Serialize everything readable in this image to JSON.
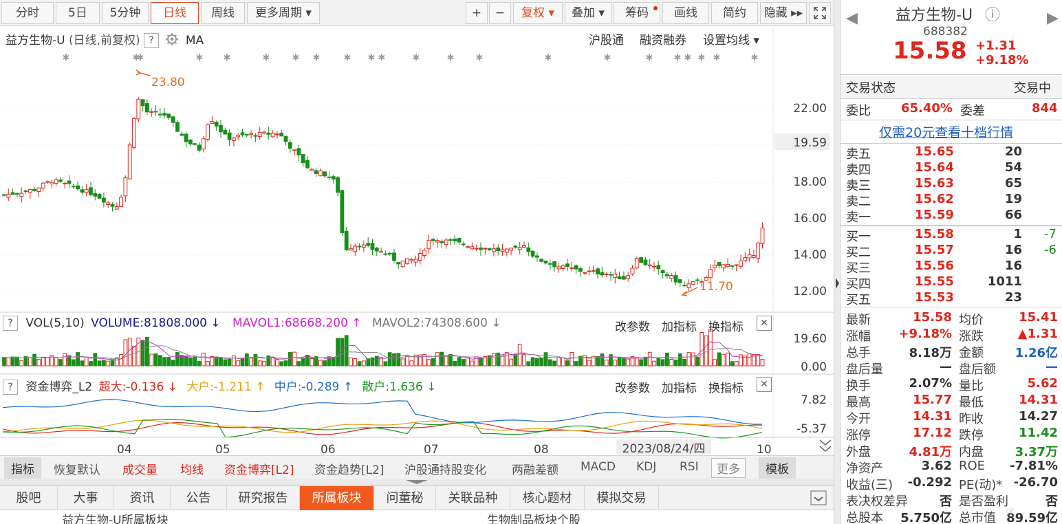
{
  "toolbar": {
    "periods": [
      "分时",
      "5日",
      "5分钟",
      "日线",
      "周线",
      "更多周期 ▾"
    ],
    "active_period": "日线",
    "zoom_in": "+",
    "zoom_out": "−",
    "fuquan": "复权 ▾",
    "overlay": "叠加 ▾",
    "chips": "筹码",
    "draw": "画线",
    "simple": "简约",
    "hide": "隐藏 ▸▸",
    "fullscreen_icon": "expand-icon"
  },
  "kline_header": {
    "title": "益方生物-U",
    "sub": "(日线,前复权)",
    "help": "?",
    "indicator": "MA",
    "links": [
      "沪股通",
      "融资融券",
      "设置均线 ▾"
    ]
  },
  "price_axis": {
    "labels": [
      "22.00",
      "19.59",
      "18.00",
      "16.00",
      "14.00",
      "12.00"
    ],
    "current_marker": "19.59"
  },
  "annotations": {
    "high": "23.80",
    "low": "11.70"
  },
  "vol_header": {
    "help": "?",
    "name": "VOL(5,10)",
    "volume": "VOLUME:81808.000 ↓",
    "mavol1": "MAVOL1:68668.200 ↑",
    "mavol2": "MAVOL2:74308.600 ↓",
    "buttons": [
      "改参数",
      "加指标",
      "换指标"
    ],
    "close": "✕",
    "axis": [
      "19.60",
      "0.00"
    ]
  },
  "fund_header": {
    "help": "?",
    "name": "资金博弈_L2",
    "super": "超大:-0.136 ↓",
    "large": "大户:-1.211 ↑",
    "medium": "中户:-0.289 ↑",
    "retail": "散户:1.636 ↓",
    "buttons": [
      "改参数",
      "加指标",
      "换指标"
    ],
    "close": "✕",
    "axis": [
      "7.82",
      "-5.37"
    ]
  },
  "x_axis": {
    "labels": [
      "04",
      "05",
      "06",
      "07",
      "08",
      "10"
    ],
    "cursor_date": "2023/08/24/四"
  },
  "indicator_tabs": {
    "items": [
      "指标",
      "恢复默认",
      "成交量",
      "均线",
      "资金博弈[L2]",
      "资金趋势[L2]",
      "沪股通持股变化",
      "两融差额",
      "MACD",
      "KDJ",
      "RSI",
      "更多"
    ],
    "template": "模板"
  },
  "bottom_tabs": {
    "items": [
      "股吧",
      "大事",
      "资讯",
      "公告",
      "研究报告",
      "所属板块",
      "问董秘",
      "关联品种",
      "核心题材",
      "模拟交易"
    ],
    "active": "所属板块"
  },
  "bottom_strip": {
    "left": "益方生物-U所属板块",
    "center": "生物制品板块个股"
  },
  "quote": {
    "name": "益方生物-U",
    "info_icon": "ⓘ",
    "code": "688382",
    "price": "15.58",
    "change": "+1.31",
    "change_pct": "+9.18%",
    "prev_icon": "◀",
    "next_icon": "▶"
  },
  "status": {
    "label": "交易状态",
    "value": "交易中"
  },
  "weibi": {
    "l1": "委比",
    "v1": "65.40%",
    "l2": "委差",
    "v2": "844"
  },
  "ten_level": "仅需20元查看十档行情",
  "sell": [
    {
      "label": "卖五",
      "price": "15.65",
      "vol": "20"
    },
    {
      "label": "卖四",
      "price": "15.64",
      "vol": "54"
    },
    {
      "label": "卖三",
      "price": "15.63",
      "vol": "65"
    },
    {
      "label": "卖二",
      "price": "15.62",
      "vol": "19"
    },
    {
      "label": "卖一",
      "price": "15.59",
      "vol": "66"
    }
  ],
  "buy": [
    {
      "label": "买一",
      "price": "15.58",
      "vol": "1",
      "chg": "-7"
    },
    {
      "label": "买二",
      "price": "15.57",
      "vol": "16",
      "chg": "-6"
    },
    {
      "label": "买三",
      "price": "15.56",
      "vol": "16",
      "chg": ""
    },
    {
      "label": "买四",
      "price": "15.55",
      "vol": "1011",
      "chg": ""
    },
    {
      "label": "买五",
      "price": "15.53",
      "vol": "23",
      "chg": ""
    }
  ],
  "stats": [
    {
      "l1": "最新",
      "v1": "15.58",
      "c1": "red",
      "l2": "均价",
      "v2": "15.41",
      "c2": "red"
    },
    {
      "l1": "涨幅",
      "v1": "+9.18%",
      "c1": "red",
      "l2": "涨跌",
      "v2": "▲1.31",
      "c2": "red"
    },
    {
      "l1": "总手",
      "v1": "8.18万",
      "c1": "",
      "l2": "金额",
      "v2": "1.26亿",
      "c2": "blue"
    },
    {
      "l1": "盘后量",
      "v1": "—",
      "c1": "",
      "l2": "盘后额",
      "v2": "—",
      "c2": "blue"
    },
    {
      "l1": "换手",
      "v1": "2.07%",
      "c1": "",
      "l2": "量比",
      "v2": "5.62",
      "c2": "red"
    },
    {
      "l1": "最高",
      "v1": "15.77",
      "c1": "red",
      "l2": "最低",
      "v2": "14.31",
      "c2": "red"
    },
    {
      "l1": "今开",
      "v1": "14.31",
      "c1": "red",
      "l2": "昨收",
      "v2": "14.27",
      "c2": ""
    },
    {
      "l1": "涨停",
      "v1": "17.12",
      "c1": "red",
      "l2": "跌停",
      "v2": "11.42",
      "c2": "green"
    },
    {
      "l1": "外盘",
      "v1": "4.81万",
      "c1": "red",
      "l2": "内盘",
      "v2": "3.37万",
      "c2": "green"
    },
    {
      "l1": "净资产",
      "v1": "3.62",
      "c1": "",
      "l2": "ROE",
      "v2": "-7.81%",
      "c2": ""
    },
    {
      "l1": "收益(三)",
      "v1": "-0.292",
      "c1": "",
      "l2": "PE(动)*",
      "v2": "-26.70",
      "c2": ""
    },
    {
      "l1": "表决权差异",
      "v1": "否",
      "c1": "",
      "l2": "是否盈利",
      "v2": "否",
      "c2": ""
    },
    {
      "l1": "总股本",
      "v1": "5.750亿",
      "c1": "",
      "l2": "总市值",
      "v2": "89.59亿",
      "c2": ""
    }
  ],
  "colors": {
    "up": "#e0261c",
    "down": "#1a8e1a",
    "accent": "#f25a1d",
    "ma": "#cc33cc",
    "link": "#1f5fbf"
  }
}
